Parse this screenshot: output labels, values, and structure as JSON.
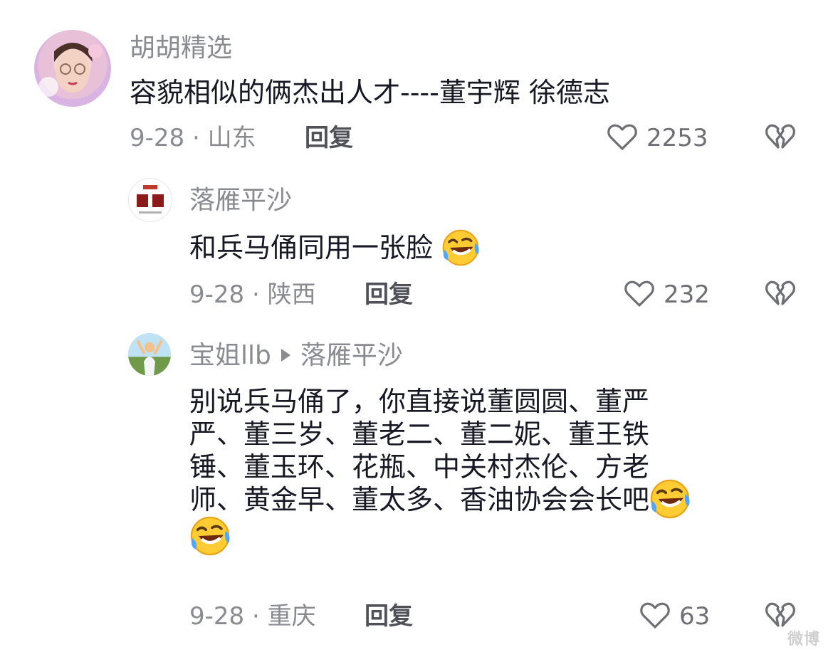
{
  "comments": [
    {
      "username": "胡胡精选",
      "text": "容貌相似的俩杰出人才----董宇辉  徐德志",
      "date_location": "9-28 · 山东",
      "reply_label": "回复",
      "likes": "2253"
    },
    {
      "username": "落雁平沙",
      "text": "和兵马俑同用一张脸",
      "date_location": "9-28 · 陕西",
      "reply_label": "回复",
      "likes": "232"
    },
    {
      "username": "宝姐llb",
      "reply_to": "落雁平沙",
      "lines": [
        "别说兵马俑了，你直接说董圆圆、董严",
        "严、董三岁、董老二、董二妮、董王铁",
        "锤、董玉环、花瓶、中关村杰伦、方老",
        "师、黄金早、董太多、香油协会会长吧"
      ],
      "date_location": "9-28 · 重庆",
      "reply_label": "回复",
      "likes": "63"
    }
  ],
  "icons": {
    "like": "heart-outline-icon",
    "dislike": "broken-heart-icon",
    "emoji": "rofl-emoji-icon"
  },
  "colors": {
    "text": "#161823",
    "secondary": "#8a8b91",
    "icon": "#6e6f75"
  },
  "watermark": "微博"
}
